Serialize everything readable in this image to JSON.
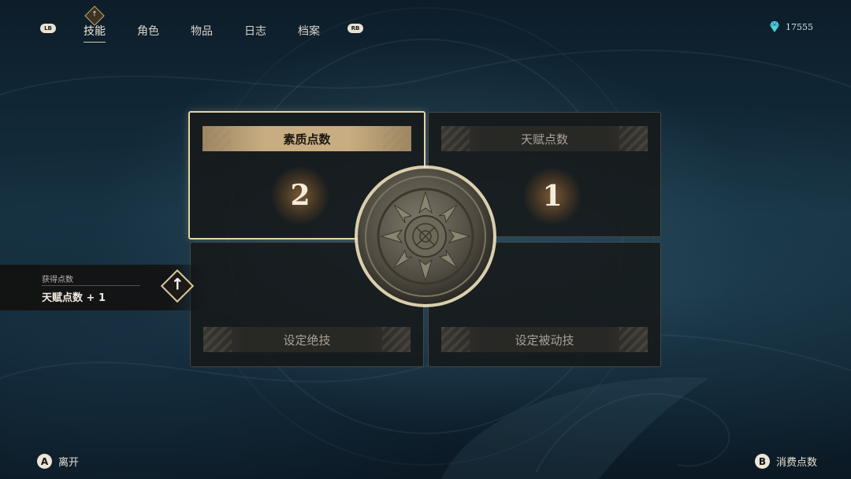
{
  "nav": {
    "left_bumper": "LB",
    "right_bumper": "RB",
    "tabs": [
      {
        "label": "技能",
        "active": true
      },
      {
        "label": "角色",
        "active": false
      },
      {
        "label": "物品",
        "active": false
      },
      {
        "label": "日志",
        "active": false
      },
      {
        "label": "档案",
        "active": false
      }
    ],
    "new_indicator_icon": "arrow-up-diamond-icon"
  },
  "currency": {
    "icon": "crystal-icon",
    "value": "17555"
  },
  "panels": {
    "attribute_points": {
      "label": "素质点数",
      "value": "2",
      "selected": true
    },
    "talent_points": {
      "label": "天赋点数",
      "value": "1",
      "selected": false
    },
    "set_ultimate": {
      "label": "设定绝技",
      "selected": false
    },
    "set_passive": {
      "label": "设定被动技",
      "selected": false
    }
  },
  "notification": {
    "title": "获得点数",
    "body": "天赋点数 + 1",
    "icon": "arrow-up-diamond-icon"
  },
  "prompts": {
    "leave": {
      "button": "A",
      "label": "离开"
    },
    "spend": {
      "button": "B",
      "label": "消费点数"
    }
  },
  "colors": {
    "accent_gold": "#c8ad82",
    "selected_border": "#e4d3a8",
    "currency_teal": "#4fd0e0"
  }
}
